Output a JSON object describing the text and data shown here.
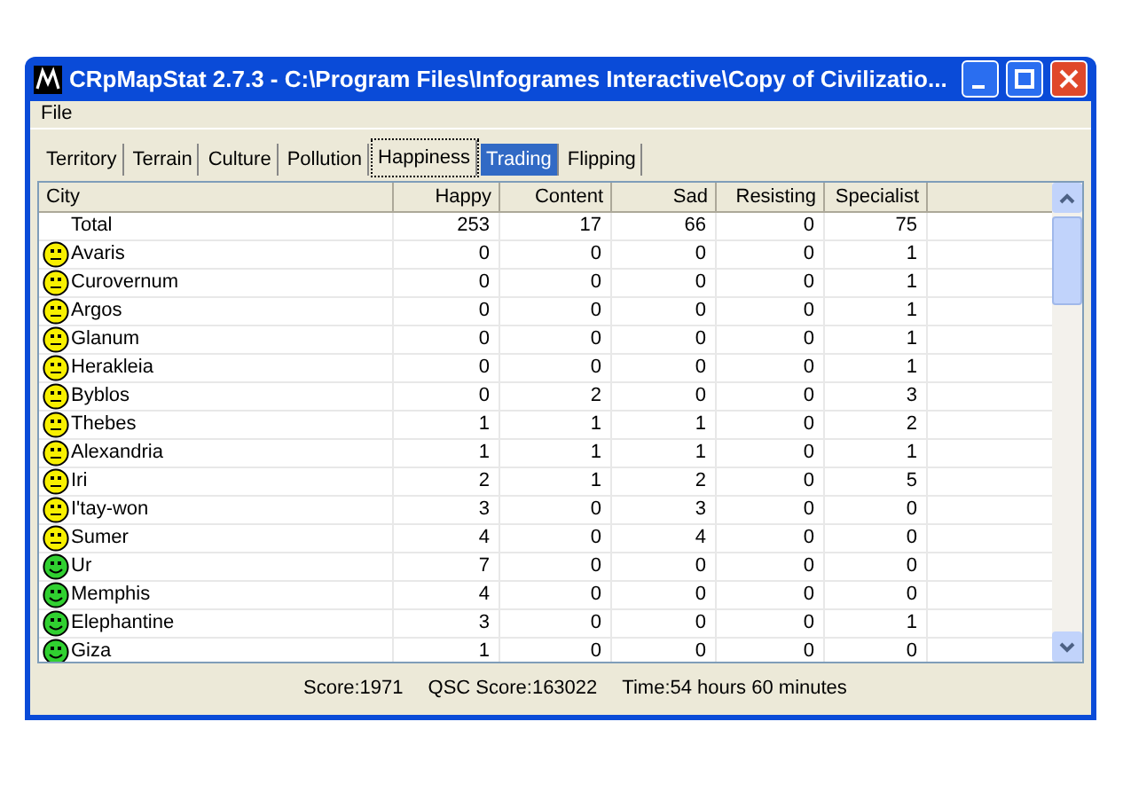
{
  "window": {
    "title": "CRpMapStat 2.7.3 - C:\\Program Files\\Infogrames Interactive\\Copy of Civilizatio..."
  },
  "menu": [
    "File"
  ],
  "tabs": [
    {
      "label": "Territory",
      "selected": false,
      "highlighted": false
    },
    {
      "label": "Terrain",
      "selected": false,
      "highlighted": false
    },
    {
      "label": "Culture",
      "selected": false,
      "highlighted": false
    },
    {
      "label": "Pollution",
      "selected": false,
      "highlighted": false
    },
    {
      "label": "Happiness",
      "selected": true,
      "highlighted": false
    },
    {
      "label": "Trading",
      "selected": false,
      "highlighted": true
    },
    {
      "label": "Flipping",
      "selected": false,
      "highlighted": false
    }
  ],
  "table": {
    "columns": [
      "City",
      "Happy",
      "Content",
      "Sad",
      "Resisting",
      "Specialist"
    ],
    "rows": [
      {
        "kind": "total",
        "cells": [
          "Total",
          "253",
          "17",
          "66",
          "0",
          "75"
        ]
      },
      {
        "kind": "content",
        "cells": [
          "Avaris",
          "0",
          "0",
          "0",
          "0",
          "1"
        ]
      },
      {
        "kind": "content",
        "cells": [
          "Curovernum",
          "0",
          "0",
          "0",
          "0",
          "1"
        ]
      },
      {
        "kind": "content",
        "cells": [
          "Argos",
          "0",
          "0",
          "0",
          "0",
          "1"
        ]
      },
      {
        "kind": "content",
        "cells": [
          "Glanum",
          "0",
          "0",
          "0",
          "0",
          "1"
        ]
      },
      {
        "kind": "content",
        "cells": [
          "Herakleia",
          "0",
          "0",
          "0",
          "0",
          "1"
        ]
      },
      {
        "kind": "content",
        "cells": [
          "Byblos",
          "0",
          "2",
          "0",
          "0",
          "3"
        ]
      },
      {
        "kind": "content",
        "cells": [
          "Thebes",
          "1",
          "1",
          "1",
          "0",
          "2"
        ]
      },
      {
        "kind": "content",
        "cells": [
          "Alexandria",
          "1",
          "1",
          "1",
          "0",
          "1"
        ]
      },
      {
        "kind": "content",
        "cells": [
          "Iri",
          "2",
          "1",
          "2",
          "0",
          "5"
        ]
      },
      {
        "kind": "content",
        "cells": [
          "I'tay-won",
          "3",
          "0",
          "3",
          "0",
          "0"
        ]
      },
      {
        "kind": "content",
        "cells": [
          "Sumer",
          "4",
          "0",
          "4",
          "0",
          "0"
        ]
      },
      {
        "kind": "happy",
        "cells": [
          "Ur",
          "7",
          "0",
          "0",
          "0",
          "0"
        ]
      },
      {
        "kind": "happy",
        "cells": [
          "Memphis",
          "4",
          "0",
          "0",
          "0",
          "0"
        ]
      },
      {
        "kind": "happy",
        "cells": [
          "Elephantine",
          "3",
          "0",
          "0",
          "0",
          "1"
        ]
      },
      {
        "kind": "happy",
        "cells": [
          "Giza",
          "1",
          "0",
          "0",
          "0",
          "0"
        ]
      }
    ]
  },
  "status_bar": [
    "Score:1971",
    "QSC Score:163022",
    "Time:54 hours 60 minutes"
  ]
}
